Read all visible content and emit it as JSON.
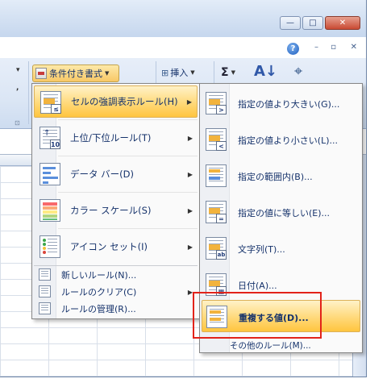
{
  "window": {
    "minimize_glyph": "—",
    "restore_glyph": "□",
    "close_glyph": "✕",
    "help_glyph": "?",
    "mdi_minimize": "–",
    "mdi_restore": "▫",
    "mdi_close": "✕"
  },
  "ribbon": {
    "conditional_format_label": "条件付き書式",
    "insert_label": "挿入",
    "sum_glyph": "Σ",
    "left_tool_1": "▾",
    "left_tool_2": ",",
    "group_launcher": "⊡"
  },
  "menu": {
    "items": [
      {
        "label": "セルの強調表示ルール(H)",
        "icon": "highlight-cells-icon",
        "has_submenu": true,
        "highlighted": true
      },
      {
        "label": "上位/下位ルール(T)",
        "icon": "top-bottom-icon",
        "has_submenu": true
      },
      {
        "label": "データ バー(D)",
        "icon": "data-bar-icon",
        "has_submenu": true
      },
      {
        "label": "カラー スケール(S)",
        "icon": "color-scale-icon",
        "has_submenu": true
      },
      {
        "label": "アイコン セット(I)",
        "icon": "icon-set-icon",
        "has_submenu": true
      }
    ],
    "small_items": [
      {
        "label": "新しいルール(N)...",
        "icon": "new-rule-icon"
      },
      {
        "label": "ルールのクリア(C)",
        "icon": "clear-rules-icon",
        "has_submenu": true
      },
      {
        "label": "ルールの管理(R)...",
        "icon": "manage-rules-icon"
      }
    ]
  },
  "submenu": {
    "items": [
      {
        "label": "指定の値より大きい(G)...",
        "badge": ">"
      },
      {
        "label": "指定の値より小さい(L)...",
        "badge": "<"
      },
      {
        "label": "指定の範囲内(B)...",
        "badge": ""
      },
      {
        "label": "指定の値に等しい(E)...",
        "badge": "="
      },
      {
        "label": "文字列(T)...",
        "badge": "ab"
      },
      {
        "label": "日付(A)...",
        "badge": "▦"
      },
      {
        "label": "重複する値(D)...",
        "badge": "",
        "highlighted": true
      }
    ],
    "more_rules": "その他のルール(M)..."
  },
  "colors": {
    "highlight": "#ffd97a",
    "annotation_red": "#e2231a",
    "text": "#15326b"
  }
}
